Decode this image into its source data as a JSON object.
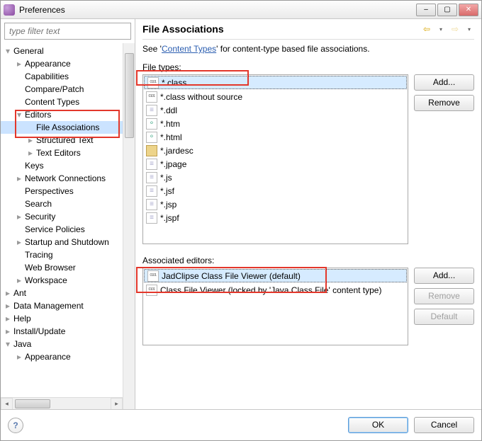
{
  "window": {
    "title": "Preferences"
  },
  "filter": {
    "placeholder": "type filter text"
  },
  "tree": [
    {
      "label": "General",
      "level": 0,
      "exp": "▾",
      "children": [
        {
          "label": "Appearance",
          "level": 1,
          "exp": "▸"
        },
        {
          "label": "Capabilities",
          "level": 1
        },
        {
          "label": "Compare/Patch",
          "level": 1
        },
        {
          "label": "Content Types",
          "level": 1
        },
        {
          "label": "Editors",
          "level": 1,
          "exp": "▾",
          "children": [
            {
              "label": "File Associations",
              "level": 2,
              "selected": true
            },
            {
              "label": "Structured Text",
              "level": 2,
              "exp": "▸"
            },
            {
              "label": "Text Editors",
              "level": 2,
              "exp": "▸"
            }
          ]
        },
        {
          "label": "Keys",
          "level": 1
        },
        {
          "label": "Network Connections",
          "level": 1,
          "exp": "▸"
        },
        {
          "label": "Perspectives",
          "level": 1
        },
        {
          "label": "Search",
          "level": 1
        },
        {
          "label": "Security",
          "level": 1,
          "exp": "▸"
        },
        {
          "label": "Service Policies",
          "level": 1
        },
        {
          "label": "Startup and Shutdown",
          "level": 1,
          "exp": "▸"
        },
        {
          "label": "Tracing",
          "level": 1
        },
        {
          "label": "Web Browser",
          "level": 1
        },
        {
          "label": "Workspace",
          "level": 1,
          "exp": "▸"
        }
      ]
    },
    {
      "label": "Ant",
      "level": 0,
      "exp": "▸"
    },
    {
      "label": "Data Management",
      "level": 0,
      "exp": "▸"
    },
    {
      "label": "Help",
      "level": 0,
      "exp": "▸"
    },
    {
      "label": "Install/Update",
      "level": 0,
      "exp": "▸"
    },
    {
      "label": "Java",
      "level": 0,
      "exp": "▾",
      "children": [
        {
          "label": "Appearance",
          "level": 1,
          "exp": "▸"
        }
      ]
    }
  ],
  "page": {
    "title": "File Associations",
    "intro_prefix": "See '",
    "intro_link": "Content Types",
    "intro_suffix": "' for content-type based file associations.",
    "filetypes_label": "File types:",
    "assoc_label": "Associated editors:"
  },
  "file_types": [
    {
      "name": "*.class",
      "icon": "class",
      "selected": true
    },
    {
      "name": "*.class without source",
      "icon": "class"
    },
    {
      "name": "*.ddl",
      "icon": "doc"
    },
    {
      "name": "*.htm",
      "icon": "html"
    },
    {
      "name": "*.html",
      "icon": "html"
    },
    {
      "name": "*.jardesc",
      "icon": "jar"
    },
    {
      "name": "*.jpage",
      "icon": "doc"
    },
    {
      "name": "*.js",
      "icon": "doc"
    },
    {
      "name": "*.jsf",
      "icon": "doc"
    },
    {
      "name": "*.jsp",
      "icon": "doc"
    },
    {
      "name": "*.jspf",
      "icon": "doc"
    }
  ],
  "ft_buttons": {
    "add": "Add...",
    "remove": "Remove"
  },
  "assoc_editors": [
    {
      "name": "JadClipse Class File Viewer (default)",
      "icon": "class",
      "selected": true
    },
    {
      "name": "Class File Viewer (locked by 'Java Class File' content type)",
      "icon": "class"
    }
  ],
  "assoc_buttons": {
    "add": "Add...",
    "remove": "Remove",
    "default": "Default"
  },
  "bottom": {
    "ok": "OK",
    "cancel": "Cancel"
  }
}
